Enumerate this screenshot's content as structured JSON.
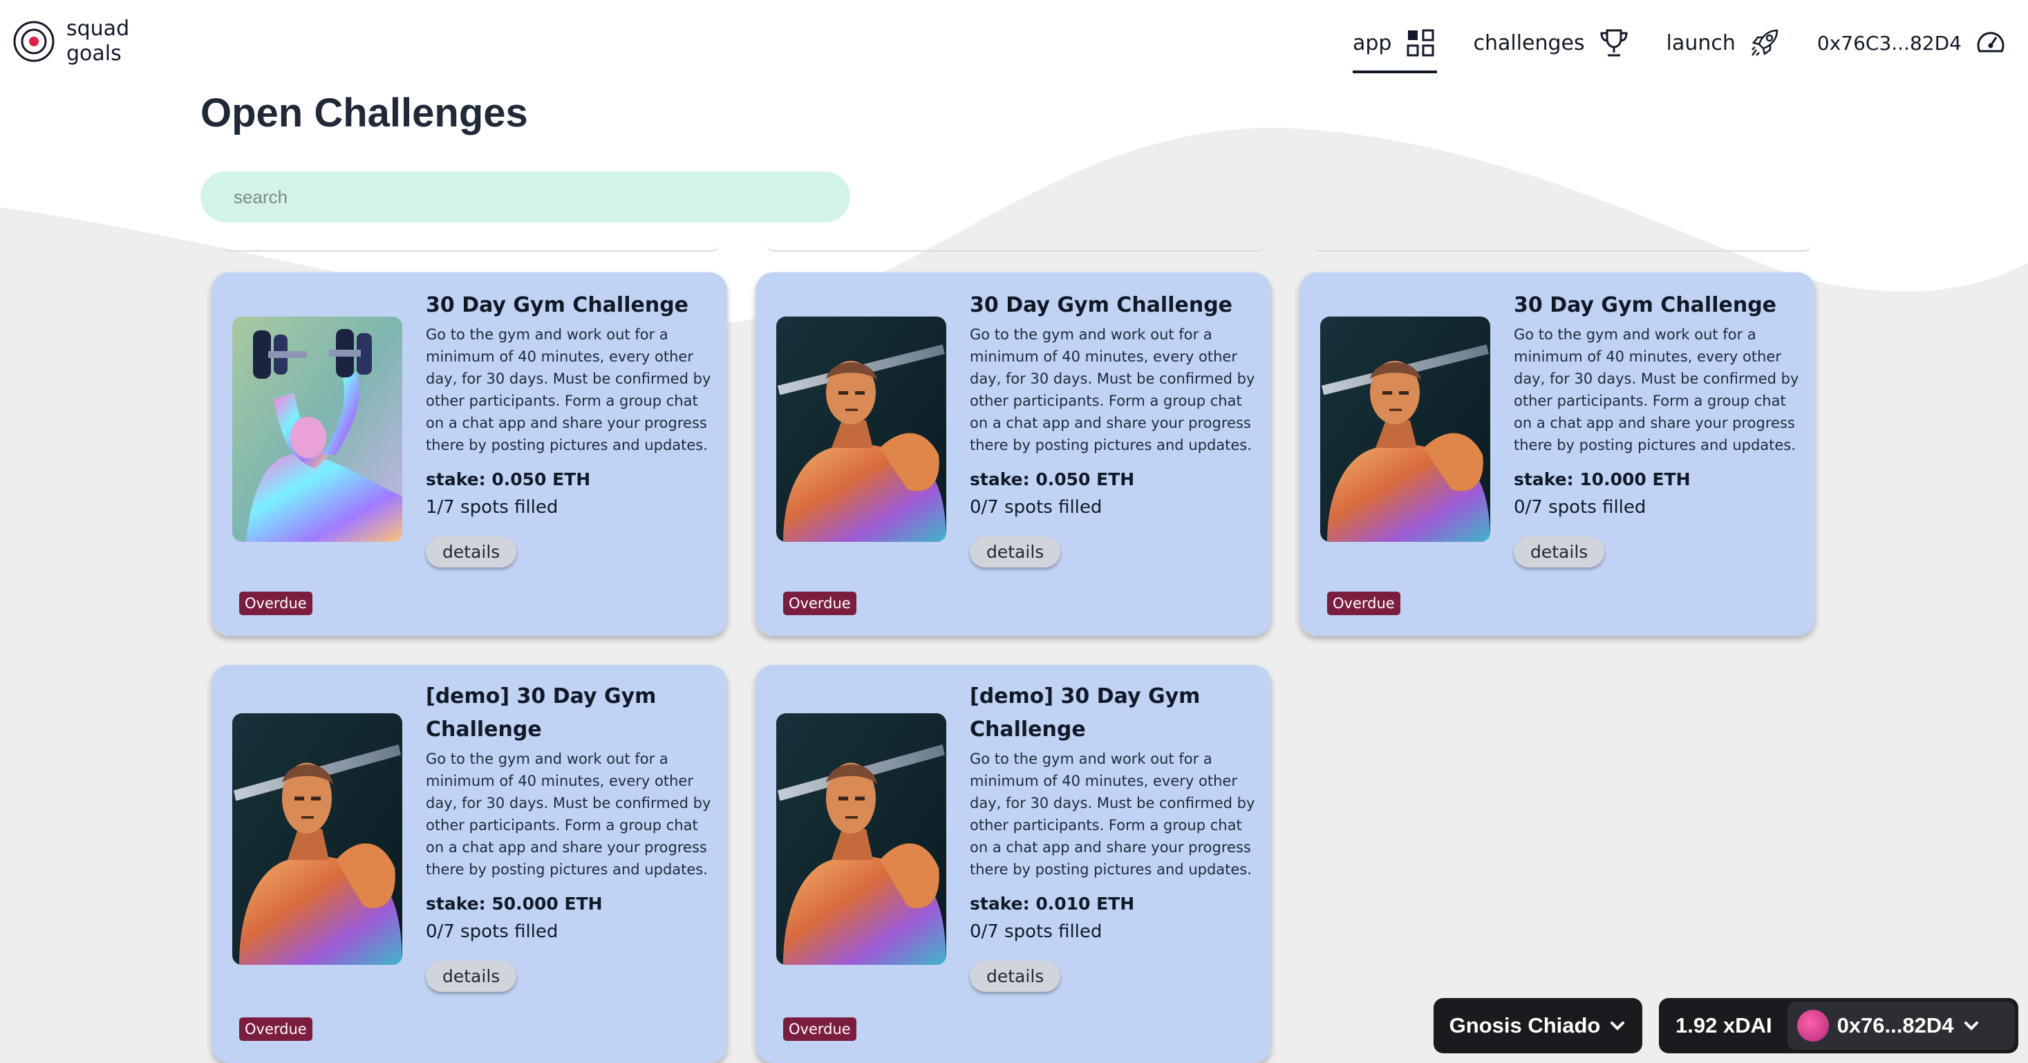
{
  "brand": {
    "line1": "squad",
    "line2": "goals",
    "icon": "target-icon"
  },
  "nav": [
    {
      "label": "app",
      "icon": "grid-icon",
      "active": true
    },
    {
      "label": "challenges",
      "icon": "trophy-icon",
      "active": false
    },
    {
      "label": "launch",
      "icon": "rocket-icon",
      "active": false
    },
    {
      "label": "0x76C3...82D4",
      "icon": "gauge-icon",
      "active": false
    }
  ],
  "page": {
    "title": "Open Challenges"
  },
  "search": {
    "placeholder": "search",
    "value": ""
  },
  "cards": [
    {
      "title": "30 Day Gym Challenge",
      "description": "Go to the gym and work out for a minimum of 40 minutes, every other day, for 30 days. Must be confirmed by other participants. Form a group chat on a chat app and share your progress there by posting pictures and updates.",
      "stake": "stake: 0.050 ETH",
      "spots": "1/7 spots filled",
      "button": "details",
      "badge": "Overdue",
      "image": "holographic-dumbbell-art"
    },
    {
      "title": "30 Day Gym Challenge",
      "description": "Go to the gym and work out for a minimum of 40 minutes, every other day, for 30 days. Must be confirmed by other participants. Form a group chat on a chat app and share your progress there by posting pictures and updates.",
      "stake": "stake: 0.050 ETH",
      "spots": "0/7 spots filled",
      "button": "details",
      "badge": "Overdue",
      "image": "bodybuilder-barbell-art"
    },
    {
      "title": "30 Day Gym Challenge",
      "description": "Go to the gym and work out for a minimum of 40 minutes, every other day, for 30 days. Must be confirmed by other participants. Form a group chat on a chat app and share your progress there by posting pictures and updates.",
      "stake": "stake: 10.000 ETH",
      "spots": "0/7 spots filled",
      "button": "details",
      "badge": "Overdue",
      "image": "bodybuilder-barbell-art"
    },
    {
      "title": "[demo] 30 Day Gym Challenge",
      "description": "Go to the gym and work out for a minimum of 40 minutes, every other day, for 30 days. Must be confirmed by other participants. Form a group chat on a chat app and share your progress there by posting pictures and updates.",
      "stake": "stake: 50.000 ETH",
      "spots": "0/7 spots filled",
      "button": "details",
      "badge": "Overdue",
      "image": "bodybuilder-barbell-art"
    },
    {
      "title": "[demo] 30 Day Gym Challenge",
      "description": "Go to the gym and work out for a minimum of 40 minutes, every other day, for 30 days. Must be confirmed by other participants. Form a group chat on a chat app and share your progress there by posting pictures and updates.",
      "stake": "stake: 0.010 ETH",
      "spots": "0/7 spots filled",
      "button": "details",
      "badge": "Overdue",
      "image": "bodybuilder-barbell-art"
    }
  ],
  "network": {
    "name": "Gnosis Chiado",
    "icon": "chevron-down-icon"
  },
  "account": {
    "balance": "1.92 xDAI",
    "address": "0x76...82D4",
    "icon": "chevron-down-icon"
  },
  "colors": {
    "card": "#c1d3f5",
    "badge": "#7b1d3f",
    "search": "#d3f3ea",
    "pill": "#1a1b1f"
  }
}
